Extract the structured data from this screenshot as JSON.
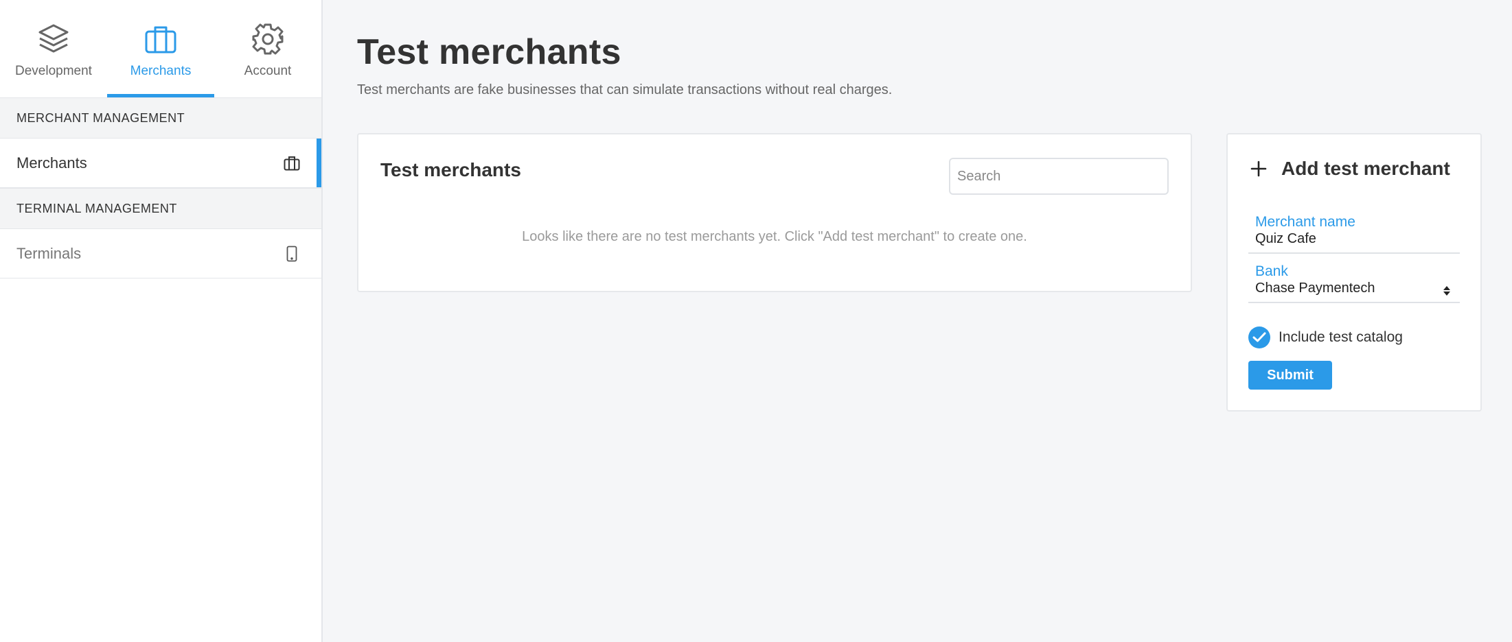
{
  "colors": {
    "accent": "#2b9ae8",
    "sidebar_bg": "#ffffff",
    "main_bg": "#f5f6f8",
    "section_bg": "#f3f4f5"
  },
  "topnav": {
    "tabs": [
      {
        "label": "Development",
        "icon": "layers-icon",
        "active": false
      },
      {
        "label": "Merchants",
        "icon": "briefcase-icon",
        "active": true
      },
      {
        "label": "Account",
        "icon": "gear-icon",
        "active": false
      }
    ]
  },
  "sidebar": {
    "sections": [
      {
        "title": "MERCHANT MANAGEMENT",
        "items": [
          {
            "label": "Merchants",
            "icon": "briefcase-icon",
            "active": true
          }
        ]
      },
      {
        "title": "TERMINAL MANAGEMENT",
        "items": [
          {
            "label": "Terminals",
            "icon": "tablet-icon",
            "active": false
          }
        ]
      }
    ]
  },
  "page": {
    "title": "Test merchants",
    "subtitle": "Test merchants are fake businesses that can simulate transactions without real charges."
  },
  "merchant_list": {
    "title": "Test merchants",
    "search_placeholder": "Search",
    "search_value": "",
    "empty_message": "Looks like there are no test merchants yet. Click \"Add test merchant\" to create one."
  },
  "add_form": {
    "title": "Add test merchant",
    "icon": "plus-icon",
    "merchant_name_label": "Merchant name",
    "merchant_name_value": "Quiz Cafe",
    "bank_label": "Bank",
    "bank_value": "Chase Paymentech",
    "include_catalog_label": "Include test catalog",
    "include_catalog_checked": true,
    "submit_label": "Submit"
  }
}
